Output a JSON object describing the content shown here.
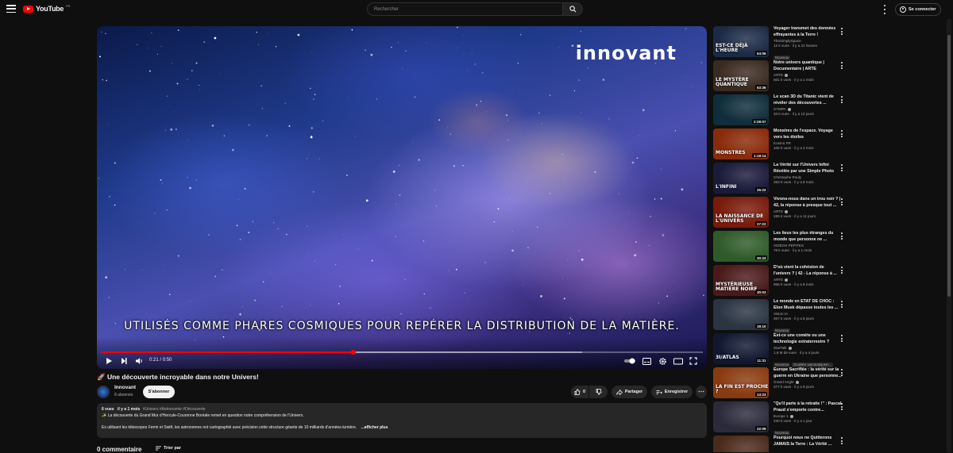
{
  "topbar": {
    "logo_text": "YouTube",
    "logo_country": "FR",
    "search_placeholder": "Rechercher",
    "signin_label": "Se connecter"
  },
  "player": {
    "brand_text": "innovant",
    "subtitle": "UTILISÉS COMME PHARES COSMIQUES POUR REPÉRER LA DISTRIBUTION DE LA MATIÈRE.",
    "time_current": "0:21",
    "time_separator": "/",
    "time_total": "0:50",
    "progress_fraction": 0.42,
    "buffered_fraction": 0.8
  },
  "video": {
    "title": "🚀 Une découverte incroyable dans notre Univers!",
    "channel_name": "Innovant",
    "channel_subs": "8 abonnés",
    "subscribe_label": "S'abonner",
    "like_count": "0",
    "share_label": "Partager",
    "save_label": "Enregistrer"
  },
  "description": {
    "views": "6 vues",
    "date": "il y a 1 mois",
    "tags": "#Univers #Astronomie #Découverte",
    "line1": "✨ La découverte du Grand Mur d'Hercule-Couronne Boréale remet en question notre compréhension de l'Univers.",
    "line2": "Es utilisant les télescopes Fermi et Swift, les astronomes ont cartographié avec précision cette structure géante de 10 milliards d'années-lumière.",
    "more_label": "...afficher plus"
  },
  "comments": {
    "count_label": "0 commentaire",
    "sort_label": "Trier par"
  },
  "recommendations": [
    {
      "title": "Voyager transmet des données effrayantes à la Terre !",
      "channel": "TheSimplySpace",
      "verified": false,
      "meta": "12 k vues · il y a 21 heures",
      "badge": "Nouveau",
      "badge2": "",
      "duration": "54:05",
      "thumb_text": "EST-CE DÉJÀ L'HEURE",
      "thumb_bg": "#1b2a45"
    },
    {
      "title": "Notre univers quantique | Documentaire | ARTE",
      "channel": "ARTE",
      "verified": true,
      "meta": "501 k vues · il y a 1 mois",
      "badge": "",
      "badge2": "",
      "duration": "53:36",
      "thumb_text": "LE MYSTÈRE QUANTIQUE",
      "thumb_bg": "#3a2a20"
    },
    {
      "title": "Le scan 3D du Titanic vient de révéler des découvertes ...",
      "channel": "SYMPA",
      "verified": true,
      "meta": "34 k vues · il y a 13 jours",
      "badge": "",
      "badge2": "",
      "duration": "2:28:07",
      "thumb_text": "",
      "thumb_bg": "#0f2d3a"
    },
    {
      "title": "Monstres de l'espace. Voyage vers les étoiles",
      "channel": "Kosmo FR",
      "verified": false,
      "meta": "105 k vues · il y a 2 mois",
      "badge": "",
      "badge2": "",
      "duration": "1:19:14",
      "thumb_text": "MONSTRES",
      "thumb_bg": "#8a2a0a"
    },
    {
      "title": "La Vérité sur l'Univers Infini Révélée par une Simple Photo",
      "channel": "Christophe Pauly",
      "verified": false,
      "meta": "393 k vues · il y a 8 mois",
      "badge": "",
      "badge2": "",
      "duration": "25:22",
      "thumb_text": "L'INFINI",
      "thumb_bg": "#1a1a3a"
    },
    {
      "title": "Vivons-nous dans un trou noir ? | 42, la réponse à presque tout ...",
      "channel": "ARTE",
      "verified": true,
      "meta": "186 k vues · il y a 11 jours",
      "badge": "",
      "badge2": "",
      "duration": "27:22",
      "thumb_text": "LA NAISSANCE DE L'UNIVERS",
      "thumb_bg": "#7a1a0a"
    },
    {
      "title": "Les lieux les plus étranges du monde que personne ne ...",
      "channel": "VIDÉOS PÉPITES",
      "verified": false,
      "meta": "79 k vues · il y a 1 mois",
      "badge": "",
      "badge2": "",
      "duration": "30:24",
      "thumb_text": "",
      "thumb_bg": "#2f5a2a"
    },
    {
      "title": "D'où vient la cohésion de l'univers ? | 42 - La réponse à ...",
      "channel": "ARTE",
      "verified": true,
      "meta": "965 k vues · il y a 8 mois",
      "badge": "",
      "badge2": "",
      "duration": "30:03",
      "thumb_text": "MYSTÉRIEUSE MATIÈRE NOIRE",
      "thumb_bg": "#4a1a1a"
    },
    {
      "title": "Le monde en ÉTAT DE CHOC : Elon Musk dépasse toutes les ...",
      "channel": "Vision IA",
      "verified": false,
      "meta": "367 k vues · il y a 6 jours",
      "badge": "Nouveau",
      "badge2": "",
      "duration": "19:10",
      "thumb_text": "",
      "thumb_bg": "#2a3442"
    },
    {
      "title": "Est-ce une comète ou une technologie extraterrestre ?",
      "channel": "StarTalk",
      "verified": true,
      "meta": "1,6 M de vues · il y a 4 jours",
      "badge": "Nouveau",
      "badge2": "Doublée automatiquem...",
      "duration": "11:31",
      "thumb_text": "3I/ATLAS",
      "thumb_bg": "#101830"
    },
    {
      "title": "Europe Sacrifiée : la vérité sur la guerre en Ukraine que personne...",
      "channel": "Grand Angle",
      "verified": true,
      "meta": "377 k vues · il y a 9 jours",
      "badge": "",
      "badge2": "",
      "duration": "13:23",
      "thumb_text": "LA FIN EST PROCHE ?",
      "thumb_bg": "#8a3a10"
    },
    {
      "title": "\"Qu'il parte à la retraite !\" : Pascal Praud s'emporte contre...",
      "channel": "Europe 1",
      "verified": true,
      "meta": "230 k vues · il y a 1 jour",
      "badge": "Nouveau",
      "badge2": "",
      "duration": "22:09",
      "thumb_text": "",
      "thumb_bg": "#2a2a3a"
    },
    {
      "title": "Pourquoi nous ne Quitterons JAMAIS la Terre : La Vérité ...",
      "channel": "",
      "verified": false,
      "meta": "",
      "badge": "",
      "badge2": "",
      "duration": "",
      "thumb_text": "LA FIN D'UN RÊVE ?",
      "thumb_bg": "#4a2a1a"
    }
  ],
  "colors": {
    "accent": "#ff0000",
    "background": "#0f0f0f",
    "surface": "#272727"
  }
}
